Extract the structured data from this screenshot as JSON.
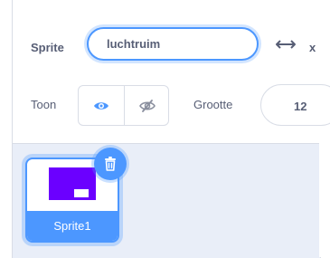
{
  "sprite_info": {
    "sprite_label": "Sprite",
    "name_value": "luchtruim",
    "x_label": "x",
    "show_label": "Toon",
    "size_label": "Grootte",
    "size_value": "12"
  },
  "sprite_list": {
    "items": [
      {
        "name": "Sprite1",
        "selected": true,
        "thumb_color": "#6b00ff"
      }
    ]
  },
  "colors": {
    "accent": "#4c97ff",
    "sprite_fill": "#6b00ff",
    "text": "#575e75"
  },
  "icons": [
    "arrows-left-right-icon",
    "eye-icon",
    "eye-slash-icon",
    "trash-icon"
  ]
}
